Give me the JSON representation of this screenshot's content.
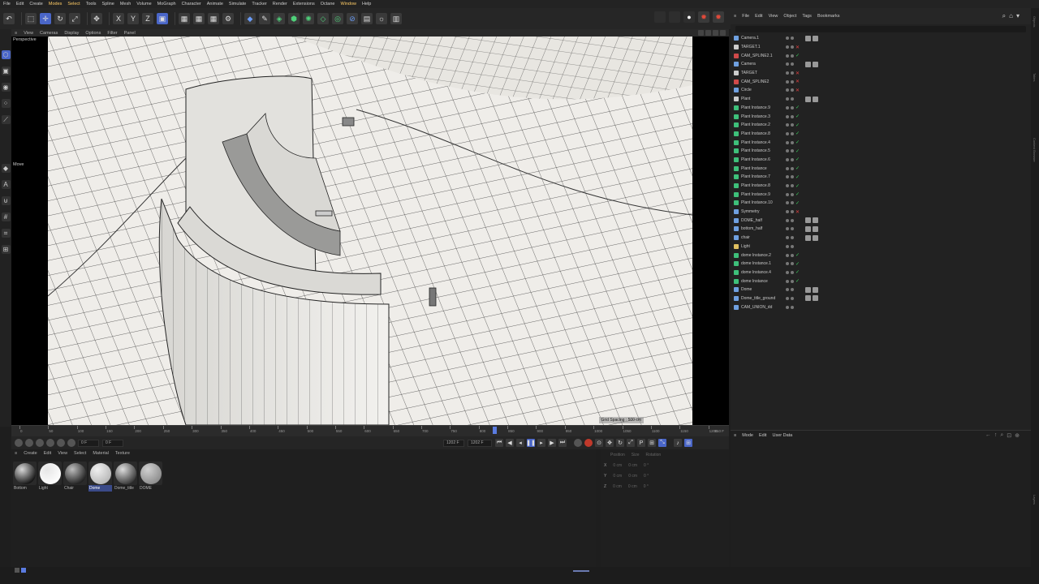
{
  "menu": [
    "File",
    "Edit",
    "Create",
    "Modes",
    "Select",
    "Tools",
    "Spline",
    "Mesh",
    "Volume",
    "MoGraph",
    "Character",
    "Animate",
    "Simulate",
    "Tracker",
    "Render",
    "Extensions",
    "Octane",
    "Window",
    "Help"
  ],
  "viewport": {
    "menu": [
      "View",
      "Cameras",
      "Display",
      "Options",
      "Filter",
      "Panel"
    ],
    "label": "Perspective",
    "tool_label": "Move",
    "grid_spacing": "Grid Spacing : 500 cm"
  },
  "timeline": {
    "ticks": [
      "0",
      "50",
      "100",
      "150",
      "200",
      "250",
      "300",
      "350",
      "400",
      "450",
      "500",
      "550",
      "600",
      "650",
      "700",
      "750",
      "800",
      "850",
      "900",
      "950",
      "1000",
      "1050",
      "1100",
      "1150",
      "1200"
    ],
    "playhead_frame": 827,
    "max_frame": 1202,
    "end_label": "810 F"
  },
  "time_controls": {
    "current": "0 F",
    "start": "0 F",
    "end": "1202 F",
    "end2": "1202 F"
  },
  "materials": {
    "menu": [
      "Create",
      "Edit",
      "View",
      "Select",
      "Material",
      "Texture"
    ],
    "items": [
      {
        "name": "Bottom",
        "colors": [
          "#0b0b0b",
          "#d9d9d9"
        ]
      },
      {
        "name": "Light",
        "colors": [
          "#ffffff",
          "#e6e6e6"
        ]
      },
      {
        "name": "Chair",
        "colors": [
          "#1a1a1a",
          "#bdbdbd"
        ]
      },
      {
        "name": "Dome",
        "colors": [
          "#b5b5b5",
          "#f0f0f0"
        ],
        "selected": true
      },
      {
        "name": "Dome_title",
        "colors": [
          "#333333",
          "#dddddd"
        ]
      },
      {
        "name": "DOME",
        "colors": [
          "#8a8a8a",
          "#d0d0d0"
        ]
      }
    ]
  },
  "coordinates": {
    "header": [
      "Position",
      "Size",
      "Rotation"
    ],
    "rows": [
      {
        "axis": "X",
        "vals": [
          "0 cm",
          "0 cm",
          "0 °"
        ]
      },
      {
        "axis": "Y",
        "vals": [
          "0 cm",
          "0 cm",
          "0 °"
        ]
      },
      {
        "axis": "Z",
        "vals": [
          "0 cm",
          "0 cm",
          "0 °"
        ]
      }
    ]
  },
  "objects": {
    "menu": [
      "File",
      "Edit",
      "View",
      "Object",
      "Tags",
      "Bookmarks"
    ],
    "items": [
      {
        "name": "Camera.1",
        "icon": "#6fa0e0",
        "state": "tags"
      },
      {
        "name": "TARGET.1",
        "icon": "#cccccc",
        "state": "x"
      },
      {
        "name": "CAM_SPLINE2.1",
        "icon": "#d04a4a",
        "state": "chk"
      },
      {
        "name": "Camera",
        "icon": "#6fa0e0",
        "state": "tags"
      },
      {
        "name": "TARGET",
        "icon": "#cccccc",
        "state": "x"
      },
      {
        "name": "CAM_SPLINE2",
        "icon": "#d04a4a",
        "state": "x"
      },
      {
        "name": "Circle",
        "icon": "#6fa0e0",
        "state": "x"
      },
      {
        "name": "Plant",
        "icon": "#cccccc",
        "state": "tags"
      },
      {
        "name": "Plant Instance.9",
        "icon": "#3ec07a",
        "state": "chk"
      },
      {
        "name": "Plant Instance.3",
        "icon": "#3ec07a",
        "state": "chk"
      },
      {
        "name": "Plant Instance.2",
        "icon": "#3ec07a",
        "state": "chk"
      },
      {
        "name": "Plant Instance.8",
        "icon": "#3ec07a",
        "state": "chk"
      },
      {
        "name": "Plant Instance.4",
        "icon": "#3ec07a",
        "state": "chk"
      },
      {
        "name": "Plant Instance.5",
        "icon": "#3ec07a",
        "state": "chk"
      },
      {
        "name": "Plant Instance.6",
        "icon": "#3ec07a",
        "state": "chk"
      },
      {
        "name": "Plant Instance",
        "icon": "#3ec07a",
        "state": "chk"
      },
      {
        "name": "Plant Instance.7",
        "icon": "#3ec07a",
        "state": "chk"
      },
      {
        "name": "Plant Instance.8",
        "icon": "#3ec07a",
        "state": "chk"
      },
      {
        "name": "Plant Instance.9",
        "icon": "#3ec07a",
        "state": "chk"
      },
      {
        "name": "Plant Instance.10",
        "icon": "#3ec07a",
        "state": "chk"
      },
      {
        "name": "Symmetry",
        "icon": "#6fa0e0",
        "state": "x"
      },
      {
        "name": "DOME_half",
        "icon": "#6fa0e0",
        "state": "tags"
      },
      {
        "name": "bottom_half",
        "icon": "#6fa0e0",
        "state": "tags"
      },
      {
        "name": "chair",
        "icon": "#6fa0e0",
        "state": "tags"
      },
      {
        "name": "Light",
        "icon": "#e0c060",
        "state": "none"
      },
      {
        "name": "dome Instance.2",
        "icon": "#3ec07a",
        "state": "chk"
      },
      {
        "name": "dome Instance.1",
        "icon": "#3ec07a",
        "state": "chk"
      },
      {
        "name": "dome Instance.4",
        "icon": "#3ec07a",
        "state": "chk"
      },
      {
        "name": "dome Instance",
        "icon": "#3ec07a",
        "state": "chk"
      },
      {
        "name": "Dome",
        "icon": "#6fa0e0",
        "state": "tags"
      },
      {
        "name": "Dome_title_ground",
        "icon": "#6fa0e0",
        "state": "tags"
      },
      {
        "name": "CAM_UNION_dd",
        "icon": "#6fa0e0",
        "state": "none"
      }
    ]
  },
  "attributes": {
    "menu": [
      "Mode",
      "Edit",
      "User Data"
    ]
  },
  "right_tabs": [
    "Objects",
    "Takes",
    "Content Browser",
    "Layers"
  ],
  "colors": {
    "accent": "#4a66c8",
    "check": "#39c65a",
    "cross": "#e04040"
  }
}
